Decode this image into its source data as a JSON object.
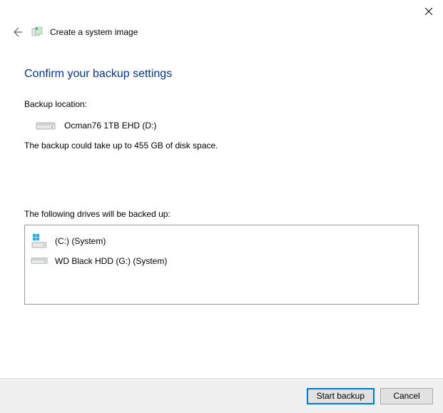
{
  "window": {
    "title": "Create a system image"
  },
  "main": {
    "heading": "Confirm your backup settings",
    "backup_location_label": "Backup location:",
    "backup_drive": "Ocman76 1TB EHD (D:)",
    "space_estimate": "The backup could take up to 455 GB of disk space.",
    "drives_label": "The following drives will be backed up:",
    "drives": [
      {
        "label": "(C:) (System)"
      },
      {
        "label": "WD Black HDD (G:) (System)"
      }
    ]
  },
  "footer": {
    "start_label": "Start backup",
    "cancel_label": "Cancel"
  }
}
